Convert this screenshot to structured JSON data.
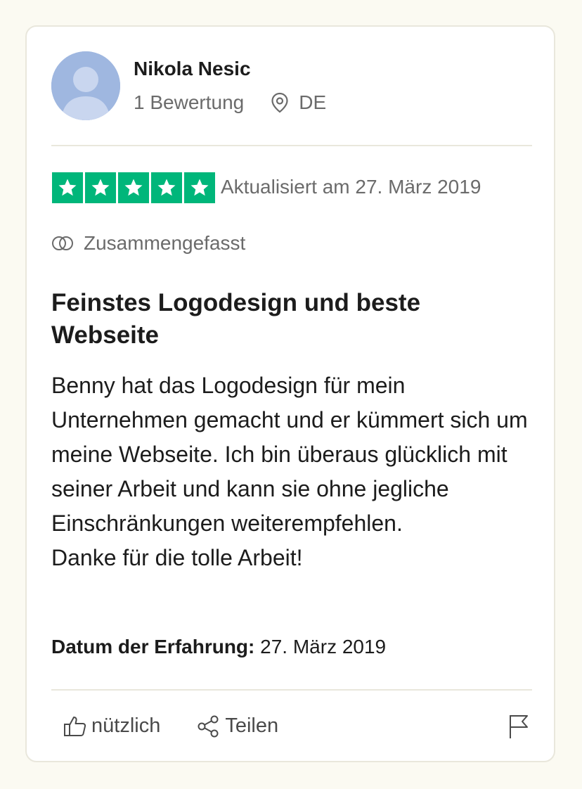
{
  "reviewer": {
    "name": "Nikola Nesic",
    "review_count": "1 Bewertung",
    "country": "DE",
    "avatar_color": "#9fb7e0"
  },
  "rating": {
    "stars": 5,
    "max_stars": 5,
    "star_color": "#00b67a",
    "updated": "Aktualisiert am 27. März 2019"
  },
  "summary_tag": "Zusammengefasst",
  "review": {
    "title": "Feinstes Logodesign und beste Webseite",
    "body_lines": [
      "Benny hat das Logodesign für mein Unternehmen gemacht und er kümmert sich um meine Webseite. Ich bin überaus glücklich mit seiner Arbeit und kann sie ohne jegliche Einschränkungen weiterempfehlen.",
      "Danke für die tolle Arbeit!"
    ]
  },
  "experience": {
    "label": "Datum der Erfahrung:",
    "date": "27. März 2019"
  },
  "actions": {
    "useful_label": "nützlich",
    "share_label": "Teilen"
  },
  "icons": {
    "location": "location-pin-icon",
    "summary": "overlapping-circles-icon",
    "useful": "thumbs-up-icon",
    "share": "share-icon",
    "report": "flag-icon",
    "star": "star-icon"
  }
}
